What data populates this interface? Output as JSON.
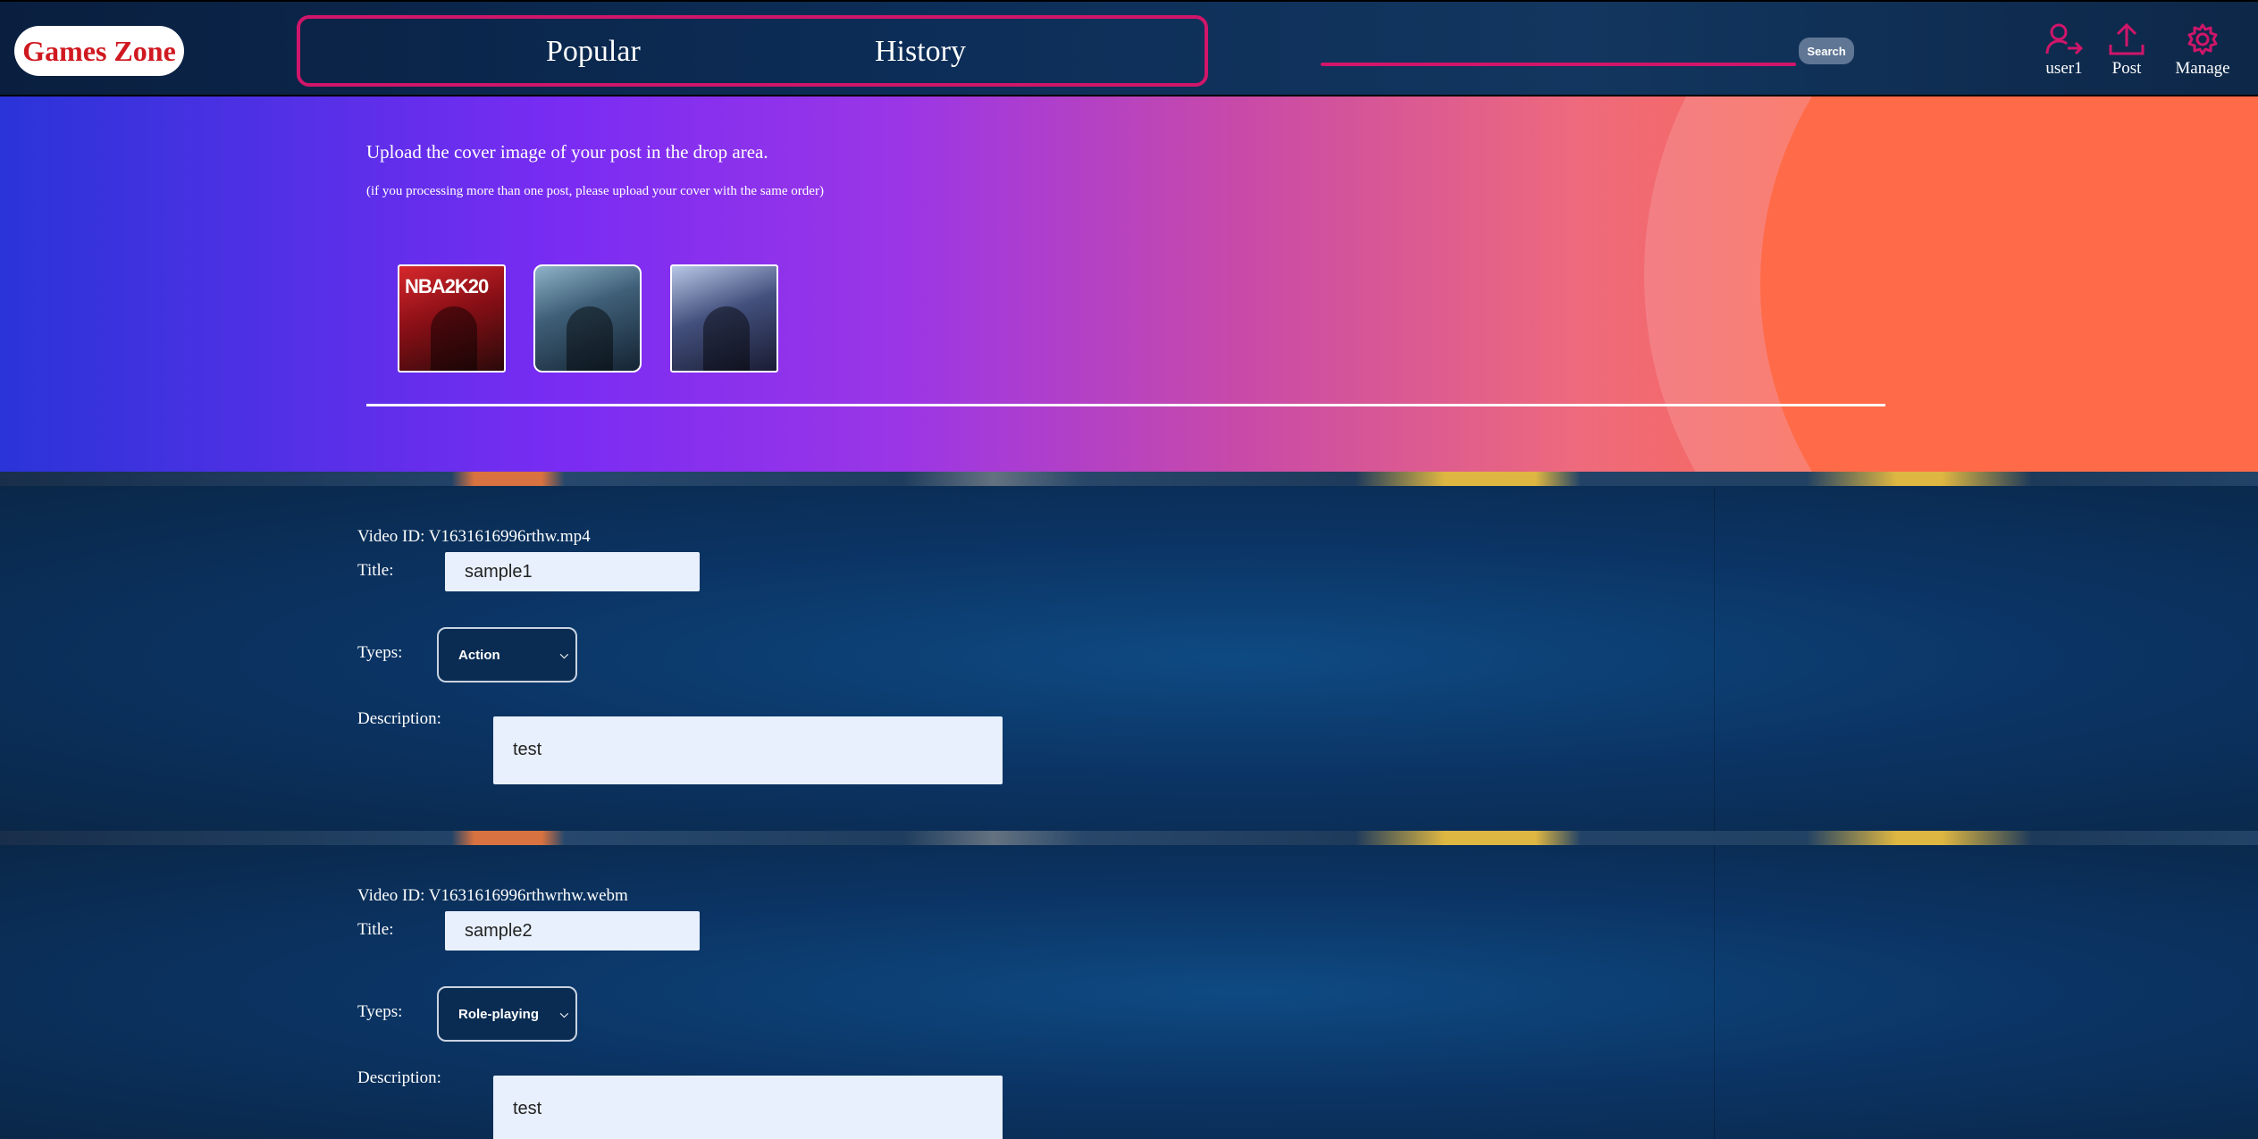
{
  "header": {
    "logo": "Games Zone",
    "nav": [
      {
        "label": "Popular"
      },
      {
        "label": "History"
      }
    ],
    "search": {
      "placeholder": "",
      "button_label": "Search"
    },
    "actions": {
      "user": {
        "label": "user1",
        "icon": "logout-icon"
      },
      "post": {
        "label": "Post",
        "icon": "upload-icon"
      },
      "manage": {
        "label": "Manage",
        "icon": "gear-icon"
      }
    }
  },
  "upload": {
    "title": "Upload the cover image of your post in the drop area.",
    "subtitle": "(if you processing more than one post, please upload your cover with the same order)",
    "covers": [
      {
        "label": "NBA2K20"
      },
      {
        "label": ""
      },
      {
        "label": ""
      }
    ]
  },
  "posts": [
    {
      "video_id_label": "Video ID: V1631616996rthw.mp4",
      "title_label": "Title:",
      "title_value": "sample1",
      "types_label": "Tyeps:",
      "type_value": "Action",
      "description_label": "Description:",
      "description_value": "test"
    },
    {
      "video_id_label": "Video ID: V1631616996rthwrhw.webm",
      "title_label": "Title:",
      "title_value": "sample2",
      "types_label": "Tyeps:",
      "type_value": "Role-playing",
      "description_label": "Description:",
      "description_value": "test"
    }
  ],
  "colors": {
    "accent": "#d0166a",
    "logo_text": "#d01820",
    "header_bg": "#0c2d57",
    "input_bg": "#e8f0fe"
  }
}
